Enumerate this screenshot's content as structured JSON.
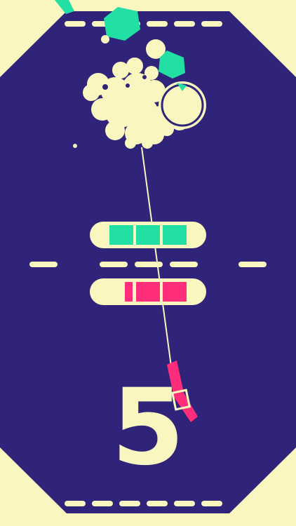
{
  "game": {
    "score": "5"
  },
  "colors": {
    "background": "#2f2479",
    "cream": "#f9f6bf",
    "teal": "#22dfa3",
    "pink": "#ff2d7a"
  },
  "team_top": {
    "color": "teal",
    "remaining_blocks": 3
  },
  "team_bottom": {
    "color": "pink",
    "remaining_blocks": 3
  }
}
